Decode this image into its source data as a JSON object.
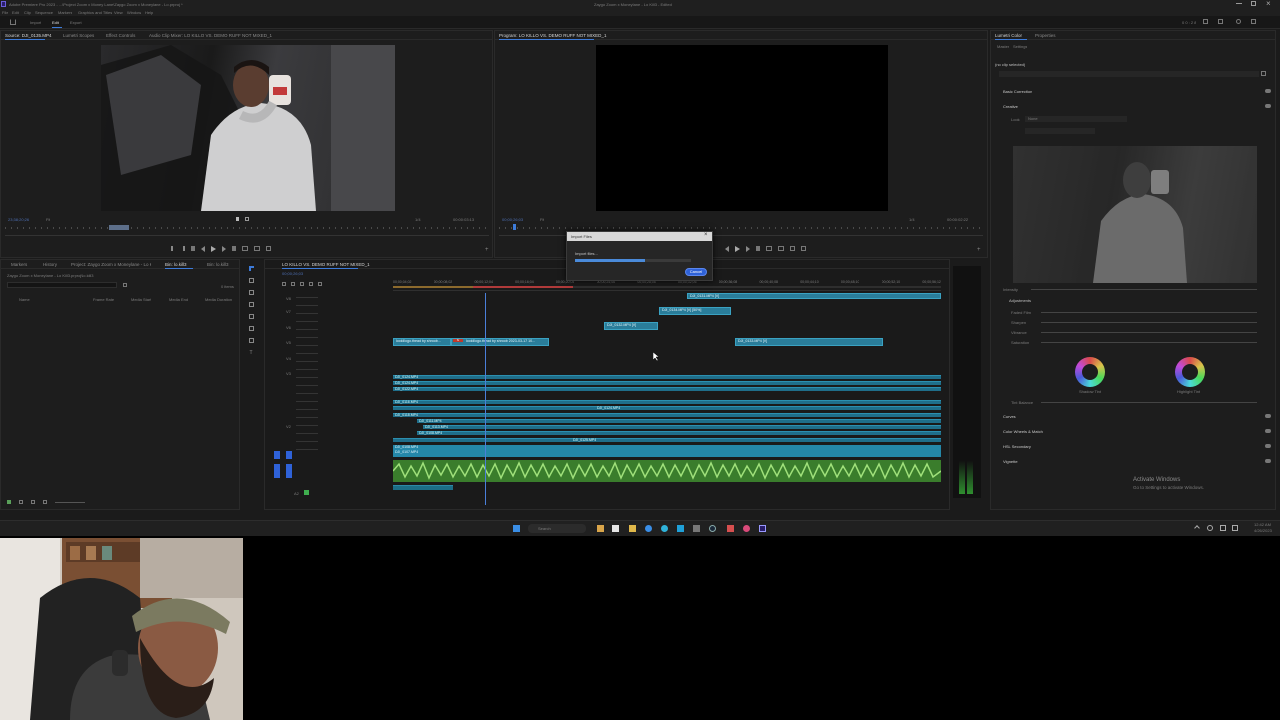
{
  "titlebar": {
    "app_title": "Adobe Premiere Pro 2023 - ...\\Project Zoom x Money Lane\\Zaygo Zoom x Moneylane - Lo.prproj *",
    "center_title": "Zaygo Zoom x Moneylane - Lo Kill3 - Edited",
    "window_controls": [
      "minimize",
      "maximize",
      "close"
    ]
  },
  "menu": [
    "File",
    "Edit",
    "Clip",
    "Sequence",
    "Markers",
    "Graphics and Titles",
    "View",
    "Window",
    "Help"
  ],
  "workspace_tabs": [
    "Import",
    "Edit",
    "Export"
  ],
  "source_monitor": {
    "tabs": [
      "Source: DJI_0135.MP4",
      "Lumetri Scopes",
      "Effect Controls",
      "Audio Clip Mixer: LO KILLO VS. DEMO RUFF NOT MIXED_1"
    ],
    "timecode_left": "23;38;20;26",
    "fit": "Fit",
    "timecode_right": "00:00:03:13",
    "zoom": "1/4"
  },
  "program_monitor": {
    "tabs": [
      "Program: LO KILLO VS. DEMO RUFF NOT MIXED_1"
    ],
    "timecode_left": "00;00;26;03",
    "fit": "Fit",
    "timecode_right": "00:00:02:22",
    "zoom": "1/4"
  },
  "project_panel": {
    "tabs": [
      "Markers",
      "History",
      "Project: Zaygo Zoom x Moneylane - Lo Kill3",
      "Bin: lo.kill3",
      "Bin: lo.kill3"
    ],
    "path": "Zaygo Zoom x Moneylane - Lo Kill3.prproj\\lo.kill3",
    "items_label": "0 items",
    "columns": [
      "Name",
      "Frame Rate",
      "Media Start",
      "Media End",
      "Media Duration"
    ]
  },
  "timeline": {
    "tab": "LO KILLO VS. DEMO RUFF NOT MIXED_1",
    "timecode": "00;00;26;03",
    "ruler_labels": [
      "00;00;04;02",
      "00;00;08;02",
      "00;00;12;04",
      "00;00;16;04",
      "00;00;20;04",
      "00;00;24;06",
      "00;00;28;06",
      "00;00;32;06",
      "00;00;36;08",
      "00;00;40;08",
      "00;00;44;10",
      "00;00;48;10",
      "00;00;52;10",
      "00;00;56;12"
    ],
    "track_labels": [
      "V8",
      "V7",
      "V6",
      "V5",
      "V4",
      "V3",
      "V2",
      "V1",
      "A1",
      "A2"
    ],
    "clips": {
      "dji_top": "DJI_0131.MP4 [V]",
      "dji_mid": "DJI_0134.MP4 [V] [50%]",
      "dji_small": "DJI_0132.MP4 [V]",
      "dji_right": "DJI_0133.MP4 [V]",
      "lyrics_left": "lookillogo.thead by shroob...",
      "lyrics_mid": "lookillogo.thead by shroob 2023-03-17 10...",
      "fx_badge": "fx",
      "row_a": "DJI_0124.MP4",
      "row_b": "DJI_0124.MP4",
      "row_c": "DJI_0122.MP4",
      "row_d": "DJI_0116.MP4",
      "row_e": "DJI_0118.MP4",
      "row_f": "DJI_0111.MP4",
      "row_g": "DJI_0113.MP4",
      "row_h": "DJI_0108.MP4",
      "mid_a": "DJI_0124.MP4",
      "mid_b": "DJI_0125.MP4",
      "v1_clip": "DJI_0108.MP4",
      "v1_clip2": "DJI_0107.MP4"
    }
  },
  "import_dialog": {
    "title": "Import Files",
    "status": "Import files...",
    "progress": 0.6,
    "cancel": "Cancel"
  },
  "lumetri": {
    "tabs": [
      "Lumetri Color",
      "Properties"
    ],
    "subtabs": [
      "Master",
      "Settings"
    ],
    "no_clip": "(no clip selected)",
    "sections": [
      "Basic Correction",
      "Creative",
      "Curves",
      "Color Wheels & Match",
      "HSL Secondary",
      "Vignette"
    ],
    "look_label": "Look",
    "look_value": "None",
    "adjustments": "Adjustments",
    "sliders": [
      "Faded Film",
      "Sharpen",
      "Vibrance",
      "Saturation"
    ],
    "tint_balance": "Tint Balance",
    "wheel_left": "Shadow Tint",
    "wheel_right": "Highlight Tint",
    "intensity": "Intensity"
  },
  "watermark": {
    "line1": "Activate Windows",
    "line2": "Go to Settings to activate Windows."
  },
  "taskbar": {
    "search": "Search",
    "time": "12:42 AM",
    "date": "4/26/2023"
  }
}
